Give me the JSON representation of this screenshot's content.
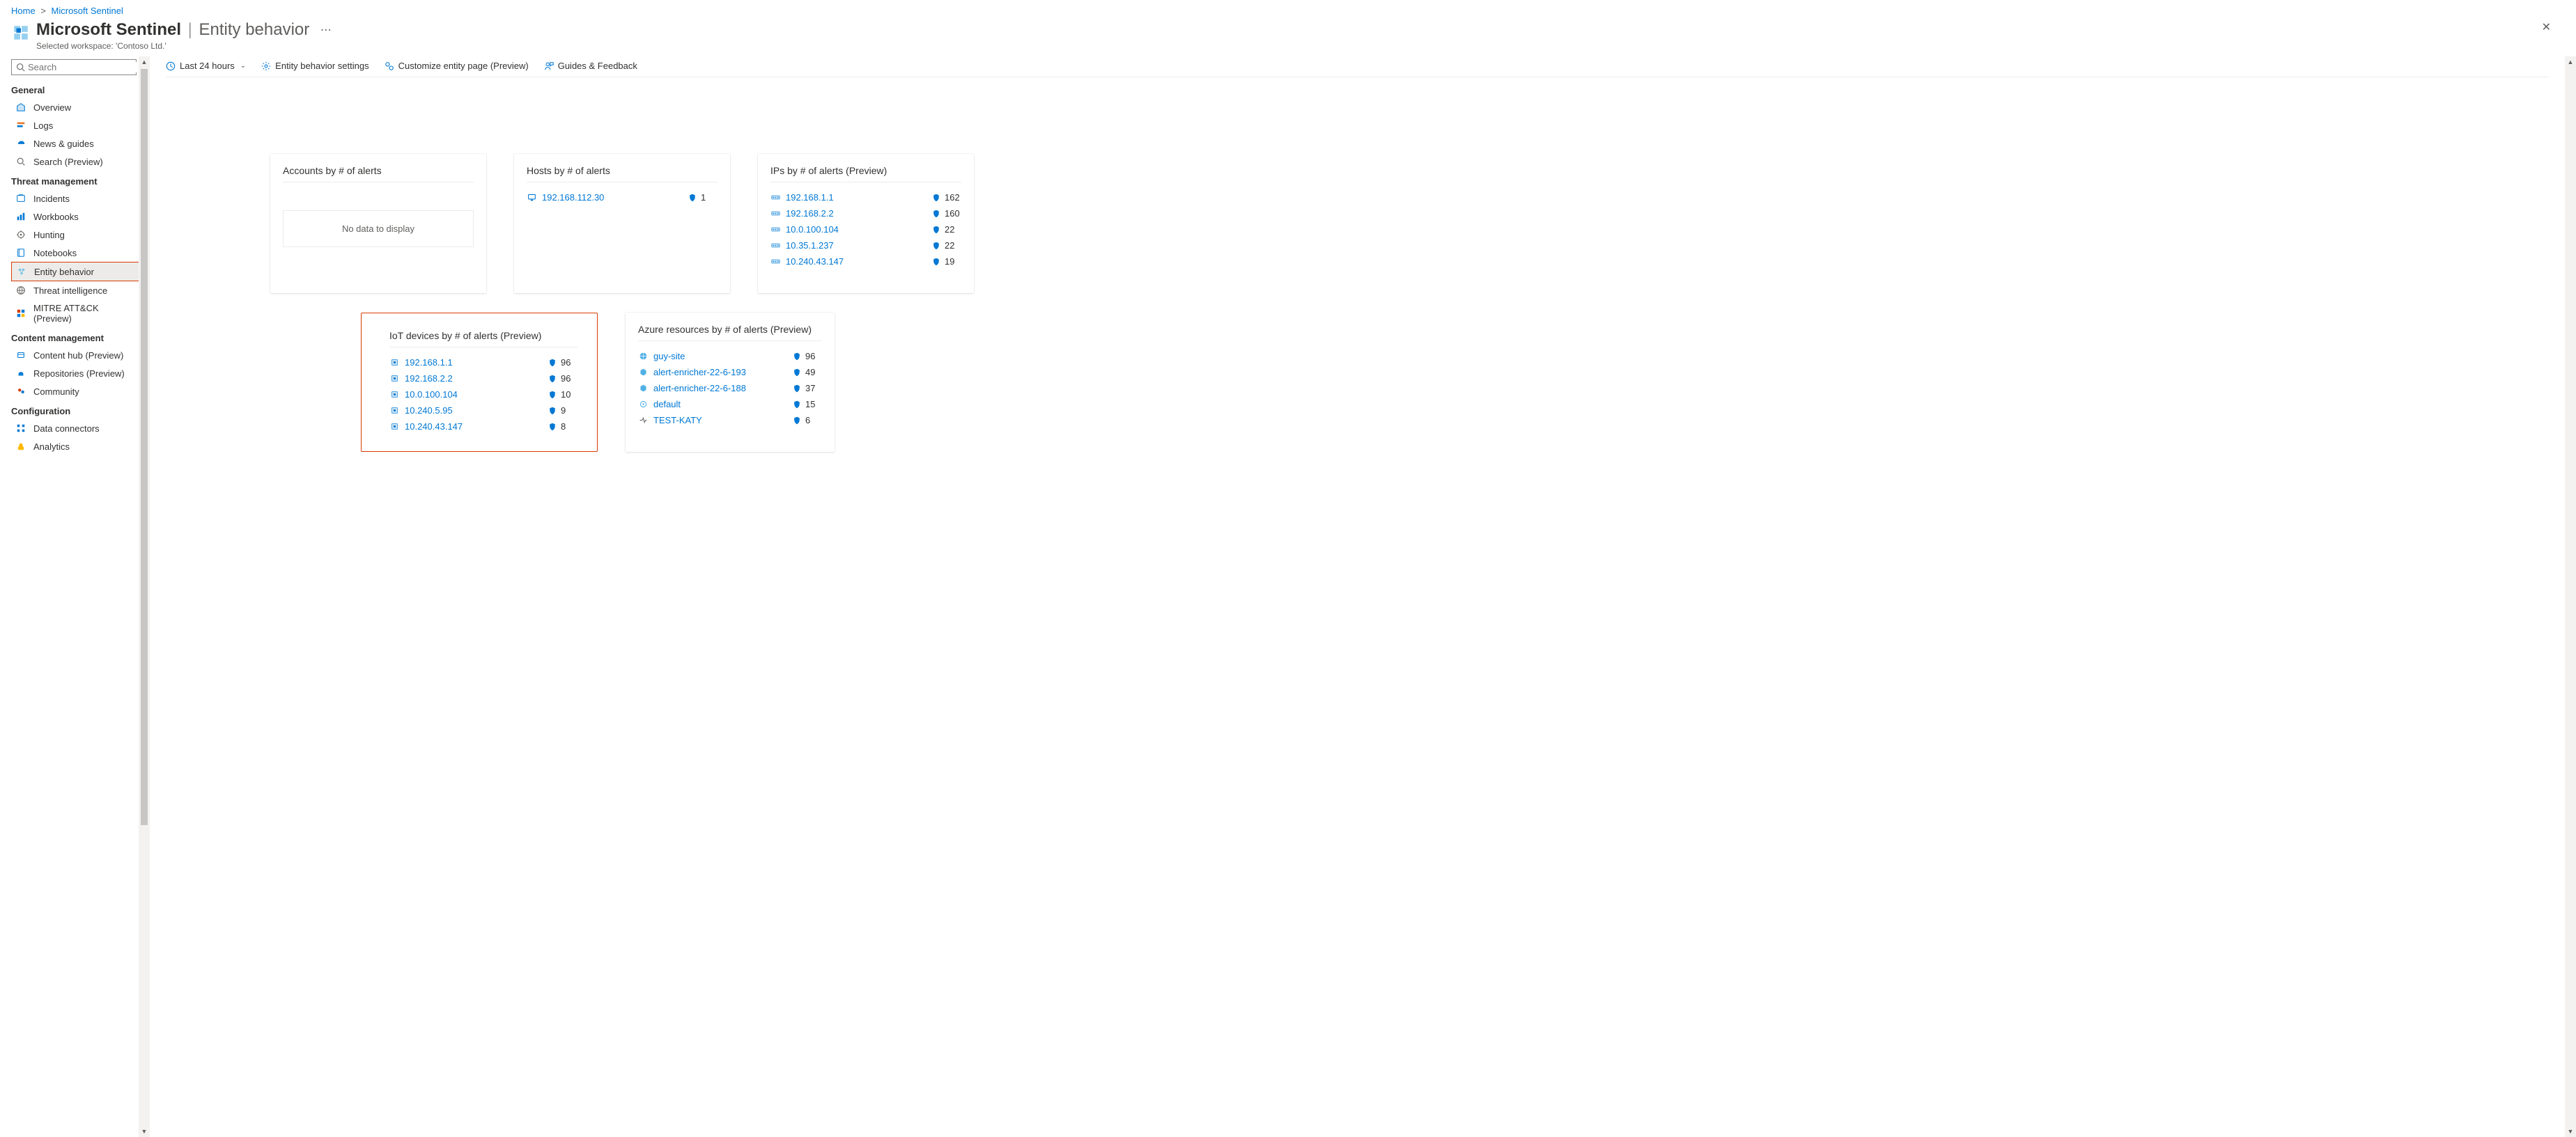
{
  "breadcrumb": {
    "home": "Home",
    "parent": "Microsoft Sentinel"
  },
  "header": {
    "title": "Microsoft Sentinel",
    "subtitle": "Entity behavior",
    "workspace": "Selected workspace: 'Contoso Ltd.'"
  },
  "search": {
    "placeholder": "Search"
  },
  "sidebar": {
    "sections": [
      {
        "label": "General",
        "items": [
          {
            "icon": "overview-icon",
            "label": "Overview"
          },
          {
            "icon": "logs-icon",
            "label": "Logs"
          },
          {
            "icon": "news-icon",
            "label": "News & guides"
          },
          {
            "icon": "search-icon",
            "label": "Search (Preview)"
          }
        ]
      },
      {
        "label": "Threat management",
        "items": [
          {
            "icon": "incidents-icon",
            "label": "Incidents"
          },
          {
            "icon": "workbooks-icon",
            "label": "Workbooks"
          },
          {
            "icon": "hunting-icon",
            "label": "Hunting"
          },
          {
            "icon": "notebooks-icon",
            "label": "Notebooks"
          },
          {
            "icon": "entity-icon",
            "label": "Entity behavior",
            "selected": true,
            "highlight": true
          },
          {
            "icon": "threatintel-icon",
            "label": "Threat intelligence"
          },
          {
            "icon": "mitre-icon",
            "label": "MITRE ATT&CK (Preview)"
          }
        ]
      },
      {
        "label": "Content management",
        "items": [
          {
            "icon": "contenthub-icon",
            "label": "Content hub (Preview)"
          },
          {
            "icon": "repos-icon",
            "label": "Repositories (Preview)"
          },
          {
            "icon": "community-icon",
            "label": "Community"
          }
        ]
      },
      {
        "label": "Configuration",
        "items": [
          {
            "icon": "dataconn-icon",
            "label": "Data connectors"
          },
          {
            "icon": "analytics-icon",
            "label": "Analytics"
          }
        ]
      }
    ]
  },
  "toolbar": {
    "time": "Last 24 hours",
    "settings": "Entity behavior settings",
    "customize": "Customize entity page (Preview)",
    "guides": "Guides & Feedback"
  },
  "cards": {
    "accounts": {
      "title": "Accounts by # of alerts",
      "empty": "No data to display"
    },
    "hosts": {
      "title": "Hosts by # of alerts",
      "rows": [
        {
          "icon": "host",
          "label": "192.168.112.30",
          "count": "1"
        }
      ]
    },
    "ips": {
      "title": "IPs by # of alerts (Preview)",
      "rows": [
        {
          "icon": "ip",
          "label": "192.168.1.1",
          "count": "162"
        },
        {
          "icon": "ip",
          "label": "192.168.2.2",
          "count": "160"
        },
        {
          "icon": "ip",
          "label": "10.0.100.104",
          "count": "22"
        },
        {
          "icon": "ip",
          "label": "10.35.1.237",
          "count": "22"
        },
        {
          "icon": "ip",
          "label": "10.240.43.147",
          "count": "19"
        }
      ]
    },
    "iot": {
      "title": "IoT devices by # of alerts (Preview)",
      "rows": [
        {
          "icon": "iot",
          "label": "192.168.1.1",
          "count": "96"
        },
        {
          "icon": "iot",
          "label": "192.168.2.2",
          "count": "96"
        },
        {
          "icon": "iot",
          "label": "10.0.100.104",
          "count": "10"
        },
        {
          "icon": "iot",
          "label": "10.240.5.95",
          "count": "9"
        },
        {
          "icon": "iot",
          "label": "10.240.43.147",
          "count": "8"
        }
      ]
    },
    "azres": {
      "title": "Azure resources by # of alerts (Preview)",
      "rows": [
        {
          "icon": "res-web",
          "label": "guy-site",
          "count": "96"
        },
        {
          "icon": "res-cube",
          "label": "alert-enricher-22-6-193",
          "count": "49"
        },
        {
          "icon": "res-cube",
          "label": "alert-enricher-22-6-188",
          "count": "37"
        },
        {
          "icon": "res-gen",
          "label": "default",
          "count": "15"
        },
        {
          "icon": "res-scale",
          "label": "TEST-KATY",
          "count": "6"
        }
      ]
    }
  }
}
